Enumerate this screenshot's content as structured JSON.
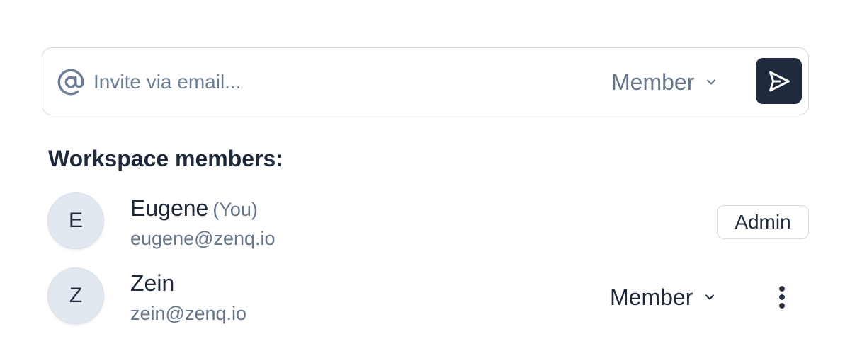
{
  "invite": {
    "placeholder": "Invite via email...",
    "role": "Member",
    "icons": {
      "at": "at-sign-icon",
      "chevron": "chevron-down-icon",
      "send": "send-icon"
    }
  },
  "members_section": {
    "title": "Workspace members:"
  },
  "members": [
    {
      "initial": "E",
      "name": "Eugene",
      "you_label": "(You)",
      "email": "eugene@zenq.io",
      "role": "Admin"
    },
    {
      "initial": "Z",
      "name": "Zein",
      "email": "zein@zenq.io",
      "role": "Member"
    }
  ],
  "colors": {
    "send_button_bg": "#1f2a3c",
    "avatar_bg": "#e2e8f0",
    "muted_text": "#64748b",
    "primary_text": "#1e293b",
    "border": "#d5dbe3"
  }
}
